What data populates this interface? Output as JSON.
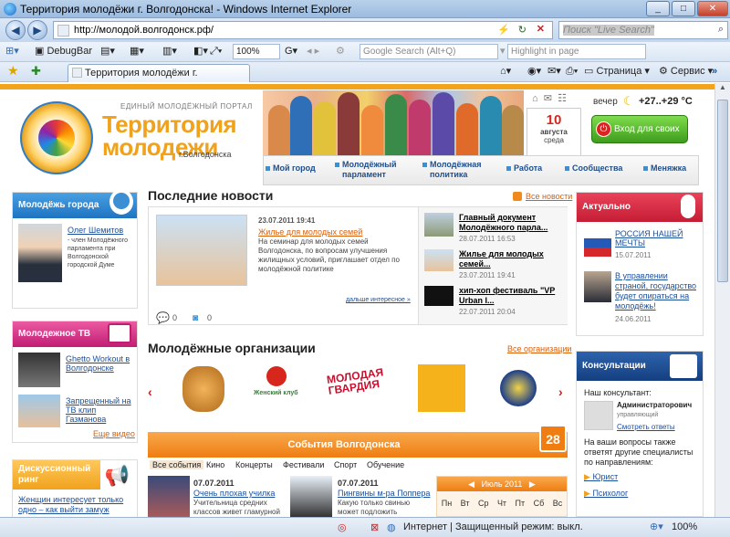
{
  "window": {
    "title": "Территория молодёжи г. Волгодонска! - Windows Internet Explorer",
    "min": "_",
    "max": "□",
    "close": "✕"
  },
  "address": {
    "url": "http://молодой.волгодонск.рф/",
    "search_placeholder": "Поиск \"Live Search\""
  },
  "toolbar": {
    "debugbar": "DebugBar",
    "zoom": "100%",
    "google": "Google Search (Alt+Q)",
    "highlight": "Highlight in page"
  },
  "tabs": {
    "active": "Территория молодёжи г. Волгодонска!",
    "page_menu": "Страница",
    "service_menu": "Сервис"
  },
  "header": {
    "portal": "ЕДИНЫЙ МОЛОДЁЖНЫЙ ПОРТАЛ",
    "logo_line1": "Территория",
    "logo_line2": "молодежи",
    "city": "г.Волгодонска",
    "date_day": "10",
    "date_month": "августа",
    "date_weekday": "среда",
    "time_of_day": "вечер",
    "temperature": "+27..+29 °C",
    "login": "Вход для своих"
  },
  "nav": [
    {
      "label": "Мой город"
    },
    {
      "label": "Молодёжный парламент"
    },
    {
      "label": "Молодёжная политика"
    },
    {
      "label": "Работа"
    },
    {
      "label": "Сообщества"
    },
    {
      "label": "Меняжка"
    }
  ],
  "left": {
    "youth_head": "Молодёжь города",
    "person_name": "Олег Шемитов",
    "person_desc": "- член Молодёжного парламента при Волгодонской городской Думе",
    "tv_head": "Молодежное ТВ",
    "tv_items": [
      {
        "title": "Ghetto Workout в Волгодонске"
      },
      {
        "title": "Запрещенный на ТВ клип Газманова"
      }
    ],
    "tv_all": "Еще видео",
    "ring_head": "Дискуссионный ринг",
    "ring_item": "Женщин интересует только одно – как выйти замуж"
  },
  "news": {
    "section": "Последние новости",
    "all": "Все новости",
    "main_date": "23.07.2011 19:41",
    "main_title": "Жилье для молодых семей",
    "main_text": "На семинар для молодых семей Волгодонска, по вопросам улучшения жилищных условий, приглашает отдел по молодёжной политике",
    "more": "дальше интересное »",
    "comments": "0",
    "views": "0",
    "side": [
      {
        "title": "Главный документ Молодёжного парла...",
        "date": "28.07.2011 16:53"
      },
      {
        "title": "Жилье для молодых семей...",
        "date": "23.07.2011 19:41"
      },
      {
        "title": "хип-хоп фестиваль \"VP Urban I...",
        "date": "22.07.2011 20:04"
      }
    ]
  },
  "orgs": {
    "section": "Молодёжные организации",
    "all": "Все организации",
    "club": "Женский клуб",
    "guard": "МОЛОДАЯ ГВАРДИЯ"
  },
  "events": {
    "head": "События Волгодонска",
    "daynum": "28",
    "tabs": [
      "Все события",
      "Кино",
      "Концерты",
      "Фестивали",
      "Спорт",
      "Обучение"
    ],
    "items": [
      {
        "date": "07.07.2011",
        "title": "Очень плохая училка",
        "text": "Учительница средних классов живет гламурной"
      },
      {
        "date": "07.07.2011",
        "title": "Пингвины м-ра Поппера",
        "text": "Какую только свинью может подложить"
      }
    ],
    "calendar_month": "Июль 2011",
    "weekdays": [
      "Пн",
      "Вт",
      "Ср",
      "Чт",
      "Пт",
      "Сб",
      "Вс"
    ]
  },
  "right": {
    "actual_head": "Актуально",
    "actual": [
      {
        "title": "РОССИЯ НАШЕЙ МЕЧТЫ",
        "date": "15.07.2011"
      },
      {
        "title": "В управлении страной, государство будет опираться на молодёжь!",
        "date": "24.06.2011"
      }
    ],
    "consult_head": "Консультации",
    "consultant_label": "Наш консультант:",
    "consultant_name": "Администраторович",
    "consultant_role": "управляющий",
    "consultant_link": "Смотреть ответы",
    "question": "На ваши вопросы также ответят другие специалисты по направлениям:",
    "specs": [
      {
        "label": "Юрист"
      },
      {
        "label": "Психолог"
      }
    ]
  },
  "status": {
    "internet": "Интернет | Защищенный режим: выкл.",
    "zoom": "100%"
  }
}
